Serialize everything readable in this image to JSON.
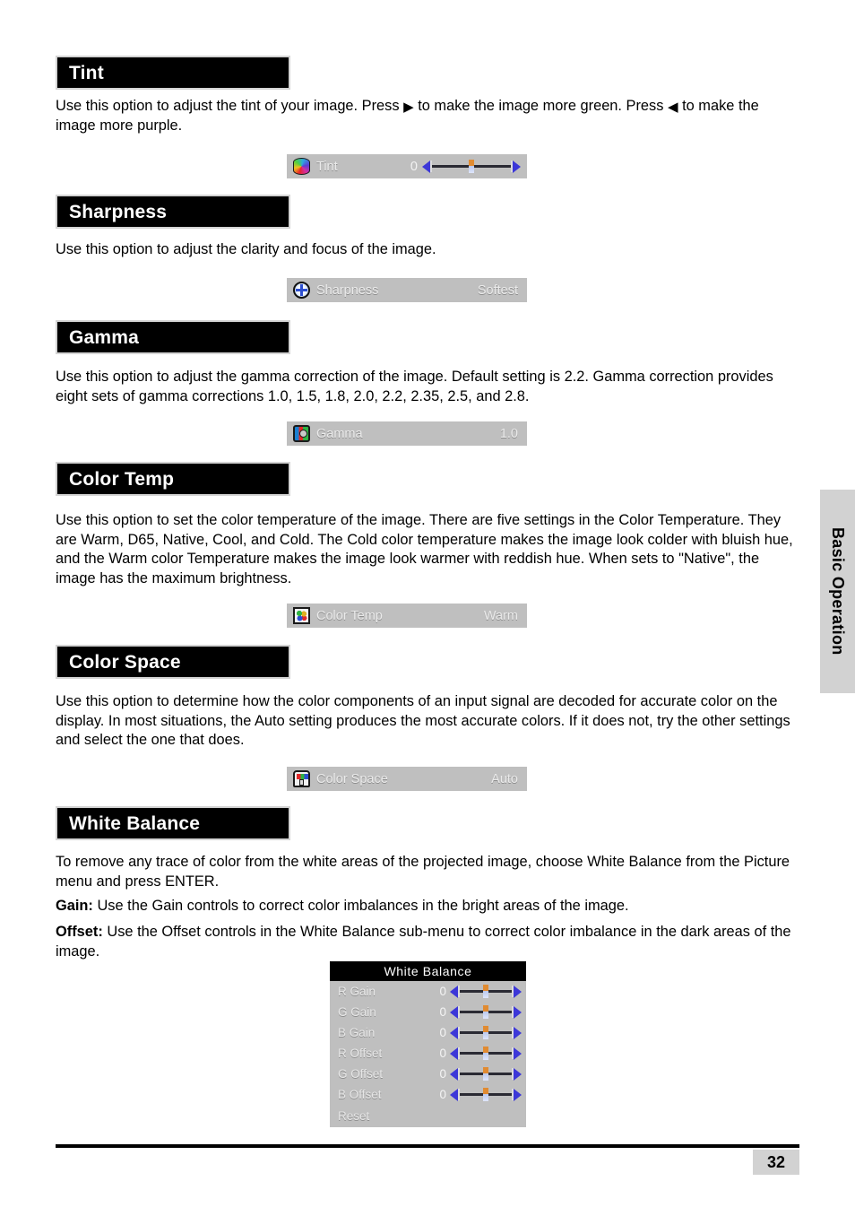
{
  "page": {
    "number": "32",
    "side_tab": "Basic Operation"
  },
  "sections": [
    {
      "heading": "Tint",
      "paragraphs": [
        "Use this option to adjust the tint of your image. Press ▶ to make the image more green. Press ◀ to make the image more purple."
      ],
      "osd": {
        "icon": "tint-color-wheel-icon",
        "label": "Tint",
        "number": "0",
        "value": "",
        "has_slider": true
      }
    },
    {
      "heading": "Sharpness",
      "paragraphs": [
        "Use this option to adjust the clarity and focus of the image."
      ],
      "osd": {
        "icon": "sharpness-crosshair-icon",
        "label": "Sharpness",
        "number": "",
        "value": "Softest",
        "has_slider": false
      }
    },
    {
      "heading": "Gamma",
      "paragraphs": [
        "Use this option to adjust the gamma correction of the image. Default setting is 2.2. Gamma correction provides eight sets of gamma corrections 1.0, 1.5, 1.8, 2.0, 2.2, 2.35, 2.5, and 2.8."
      ],
      "osd": {
        "icon": "gamma-rgb-icon",
        "label": "Gamma",
        "number": "",
        "value": "1.0",
        "has_slider": false
      }
    },
    {
      "heading": "Color Temp",
      "paragraphs": [
        "Use this option to set the color temperature of the image. There are five settings in the Color Temperature. They are Warm, D65, Native, Cool, and Cold. The Cold color temperature makes the image look colder with bluish hue, and the Warm color Temperature makes the image look warmer with reddish hue.  When sets to \"Native\", the image has the maximum brightness."
      ],
      "osd": {
        "icon": "color-temp-palette-icon",
        "label": "Color Temp",
        "number": "",
        "value": "Warm",
        "has_slider": false
      }
    },
    {
      "heading": "Color Space",
      "paragraphs": [
        "Use this option to determine how the color components of an input signal are decoded for accurate color on the display. In most situations, the Auto setting produces the most accurate colors. If it does not, try the other settings and select the one that does."
      ],
      "osd": {
        "icon": "color-space-printer-icon",
        "label": "Color Space",
        "number": "",
        "value": "Auto",
        "has_slider": false
      }
    },
    {
      "heading": "White Balance",
      "paragraphs": [
        "To remove any trace of color from the white areas of the projected image, choose White Balance from the Picture menu and press ENTER."
      ],
      "labeled_paragraphs": [
        {
          "term": "Gain:",
          "text": " Use the Gain controls to correct color imbalances in the bright areas of the image."
        },
        {
          "term": "Offset:",
          "text": " Use the Offset controls in the White Balance sub-menu to correct color imbalance in the dark areas of the image."
        }
      ]
    }
  ],
  "white_balance_menu": {
    "title": "White Balance",
    "rows": [
      {
        "label": "R Gain",
        "value": "0"
      },
      {
        "label": "G Gain",
        "value": "0"
      },
      {
        "label": "B Gain",
        "value": "0"
      },
      {
        "label": "R Offset",
        "value": "0"
      },
      {
        "label": "G Offset",
        "value": "0"
      },
      {
        "label": "B Offset",
        "value": "0"
      }
    ],
    "reset_label": "Reset"
  },
  "colors": {
    "osd_background": "#bfbfbf",
    "osd_title_background": "#000000",
    "arrow_blue": "#3c37d8",
    "tab_gray": "#d2d2d2"
  }
}
